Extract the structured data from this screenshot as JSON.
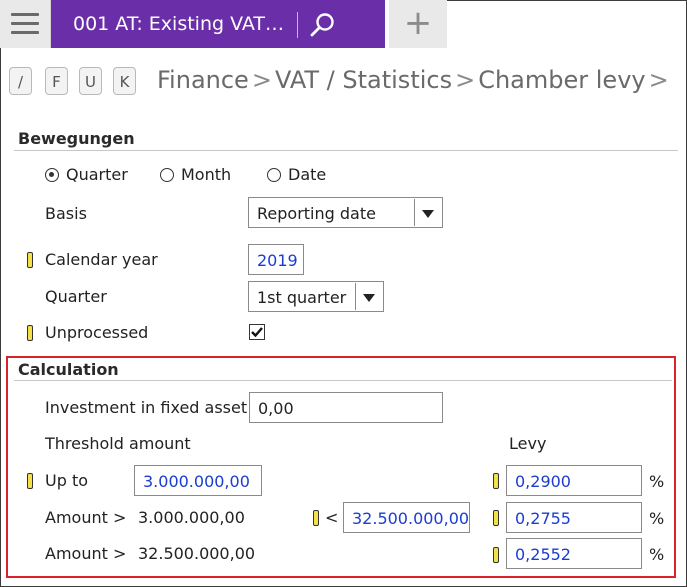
{
  "tab": {
    "title": "001  AT: Existing VAT…"
  },
  "hotkeys": [
    "/",
    "F",
    "U",
    "K"
  ],
  "breadcrumb": {
    "items": [
      "Finance",
      "VAT / Statistics",
      "Chamber levy"
    ],
    "separator": ">"
  },
  "bewegungen": {
    "title": "Bewegungen",
    "period_options": [
      {
        "label": "Quarter",
        "selected": true
      },
      {
        "label": "Month",
        "selected": false
      },
      {
        "label": "Date",
        "selected": false
      }
    ],
    "basis": {
      "label": "Basis",
      "value": "Reporting date"
    },
    "calendar_year": {
      "label": "Calendar year",
      "value": "2019"
    },
    "quarter": {
      "label": "Quarter",
      "value": "1st quarter"
    },
    "unprocessed": {
      "label": "Unprocessed",
      "checked": true
    }
  },
  "calculation": {
    "title": "Calculation",
    "investment": {
      "label": "Investment in fixed asset",
      "value": "0,00"
    },
    "threshold_header": "Threshold amount",
    "levy_header": "Levy",
    "rows": [
      {
        "label": "Up to",
        "amount": "3.000.000,00",
        "levy": "0,2900",
        "unit": "%"
      },
      {
        "label": "Amount >",
        "from": "3.000.000,00",
        "lt": "<",
        "to": "32.500.000,00",
        "levy": "0,2755",
        "unit": "%"
      },
      {
        "label": "Amount >",
        "from": "32.500.000,00",
        "levy": "0,2552",
        "unit": "%"
      }
    ]
  },
  "colors": {
    "accent": "#6a2fa8",
    "highlight_border": "#d9232b",
    "value_text": "#1a3cd1",
    "required_marker": "#f4e14a"
  }
}
